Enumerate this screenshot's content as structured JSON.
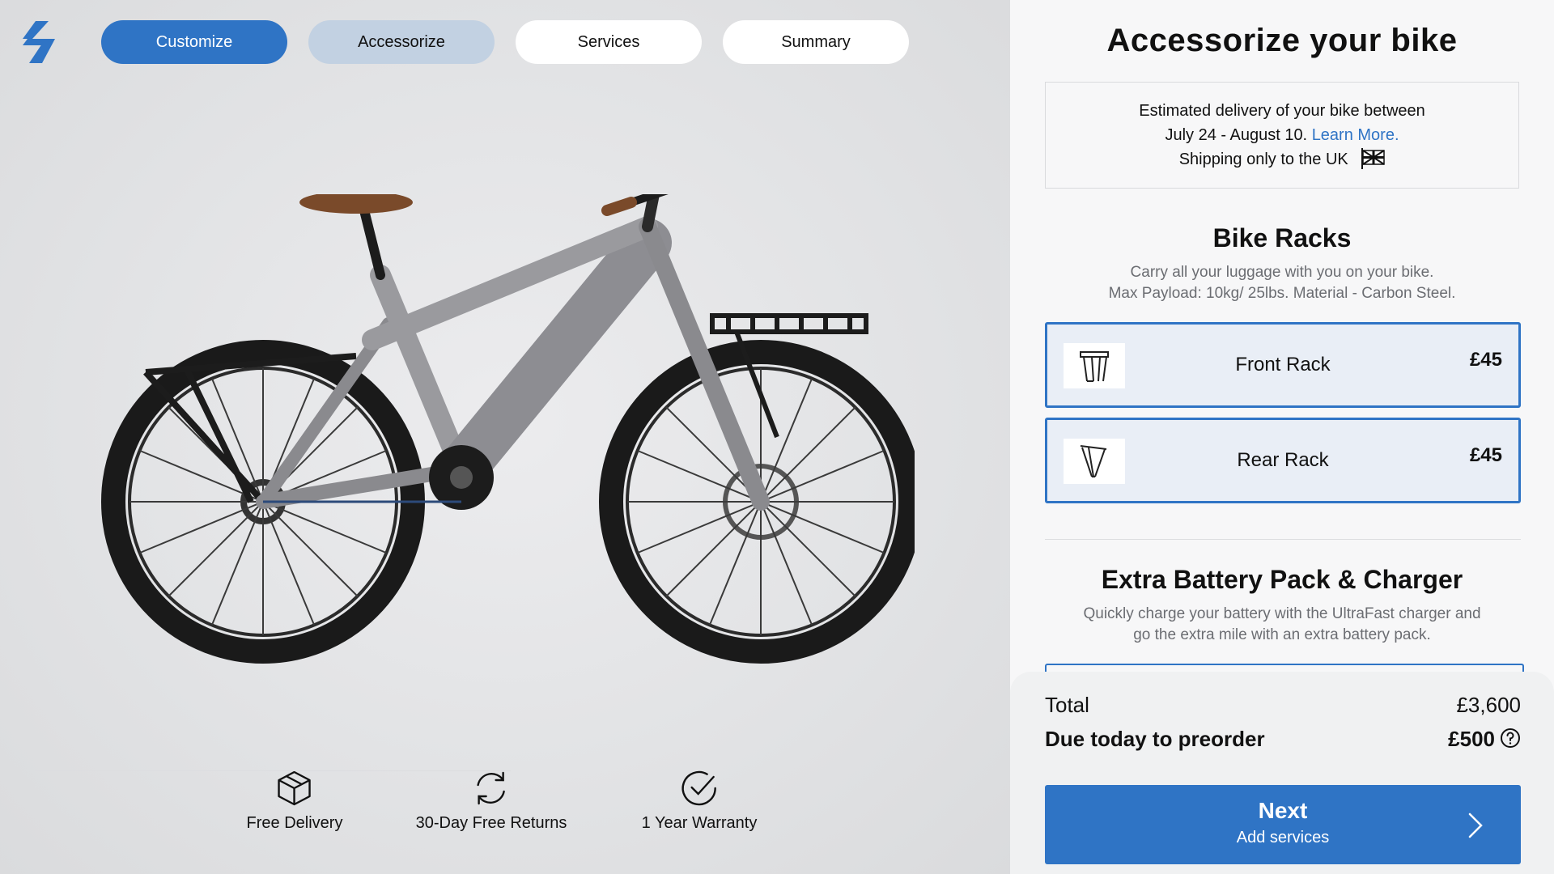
{
  "steps": [
    {
      "label": "Customize",
      "state": "done"
    },
    {
      "label": "Accessorize",
      "state": "active"
    },
    {
      "label": "Services",
      "state": "upcoming"
    },
    {
      "label": "Summary",
      "state": "upcoming"
    }
  ],
  "perks": [
    {
      "label": "Free Delivery",
      "icon": "box-icon"
    },
    {
      "label": "30-Day Free Returns",
      "icon": "refresh-icon"
    },
    {
      "label": "1 Year Warranty",
      "icon": "check-circle-icon"
    }
  ],
  "panel": {
    "title": "Accessorize your bike",
    "delivery": {
      "line1": "Estimated delivery of your bike between",
      "line2": "July 24 - August 10.",
      "learn_more": "Learn More.",
      "line3": "Shipping only to the UK"
    },
    "racks": {
      "title": "Bike Racks",
      "desc1": "Carry all your luggage with you on your bike.",
      "desc2": "Max Payload: 10kg/ 25lbs. Material - Carbon Steel.",
      "items": [
        {
          "name": "Front Rack",
          "price": "£45"
        },
        {
          "name": "Rear Rack",
          "price": "£45"
        }
      ]
    },
    "battery": {
      "title": "Extra Battery Pack & Charger",
      "desc1": "Quickly charge your battery with the UltraFast charger and",
      "desc2": "go the extra mile with an extra battery pack."
    }
  },
  "summary": {
    "total_label": "Total",
    "total_value": "£3,600",
    "due_label": "Due today to preorder",
    "due_value": "£500",
    "next_label": "Next",
    "next_sub": "Add services"
  },
  "colors": {
    "accent": "#2f74c5",
    "step_active": "#c2d1e2",
    "selected_bg": "#e9eef6"
  }
}
